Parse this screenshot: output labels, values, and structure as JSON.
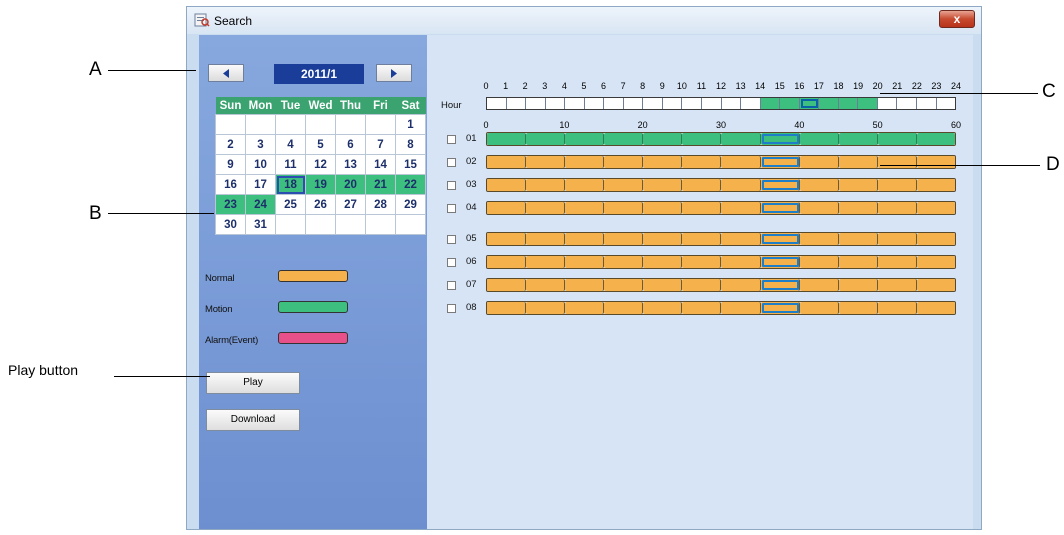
{
  "window": {
    "title": "Search",
    "close_label": "x"
  },
  "calendar": {
    "month_label": "2011/1",
    "weekdays": [
      "Sun",
      "Mon",
      "Tue",
      "Wed",
      "Thu",
      "Fri",
      "Sat"
    ],
    "weeks": [
      [
        "",
        "",
        "",
        "",
        "",
        "",
        "1"
      ],
      [
        "2",
        "3",
        "4",
        "5",
        "6",
        "7",
        "8"
      ],
      [
        "9",
        "10",
        "11",
        "12",
        "13",
        "14",
        "15"
      ],
      [
        "16",
        "17",
        "18",
        "19",
        "20",
        "21",
        "22"
      ],
      [
        "23",
        "24",
        "25",
        "26",
        "27",
        "28",
        "29"
      ],
      [
        "30",
        "31",
        "",
        "",
        "",
        "",
        ""
      ]
    ],
    "recorded_days": [
      "18",
      "19",
      "20",
      "21",
      "22",
      "23",
      "24"
    ],
    "selected_day": "18"
  },
  "legend": [
    {
      "label": "Normal",
      "color": "#f5b14c"
    },
    {
      "label": "Motion",
      "color": "#3dbf7f"
    },
    {
      "label": "Alarm(Event)",
      "color": "#e8508a"
    }
  ],
  "buttons": {
    "play": "Play",
    "download": "Download"
  },
  "timeline": {
    "hour_label": "Hour",
    "hour_ticks": [
      "0",
      "1",
      "2",
      "3",
      "4",
      "5",
      "6",
      "7",
      "8",
      "9",
      "10",
      "11",
      "12",
      "13",
      "14",
      "15",
      "16",
      "17",
      "18",
      "19",
      "20",
      "21",
      "22",
      "23",
      "24"
    ],
    "hour_recorded_from": 14,
    "hour_recorded_to": 20,
    "current_hour_segment": 16,
    "minute_ticks": [
      "0",
      "10",
      "20",
      "30",
      "40",
      "50",
      "60"
    ],
    "channels": [
      {
        "label": "01",
        "type": "motion"
      },
      {
        "label": "02",
        "type": "normal"
      },
      {
        "label": "03",
        "type": "normal"
      },
      {
        "label": "04",
        "type": "normal"
      },
      {
        "label": "05",
        "type": "normal"
      },
      {
        "label": "06",
        "type": "normal"
      },
      {
        "label": "07",
        "type": "normal"
      },
      {
        "label": "08",
        "type": "normal"
      }
    ],
    "current_minute_segment": 7
  },
  "annotations": {
    "a": "A",
    "b": "B",
    "c": "C",
    "d": "D",
    "play_button": "Play button"
  }
}
